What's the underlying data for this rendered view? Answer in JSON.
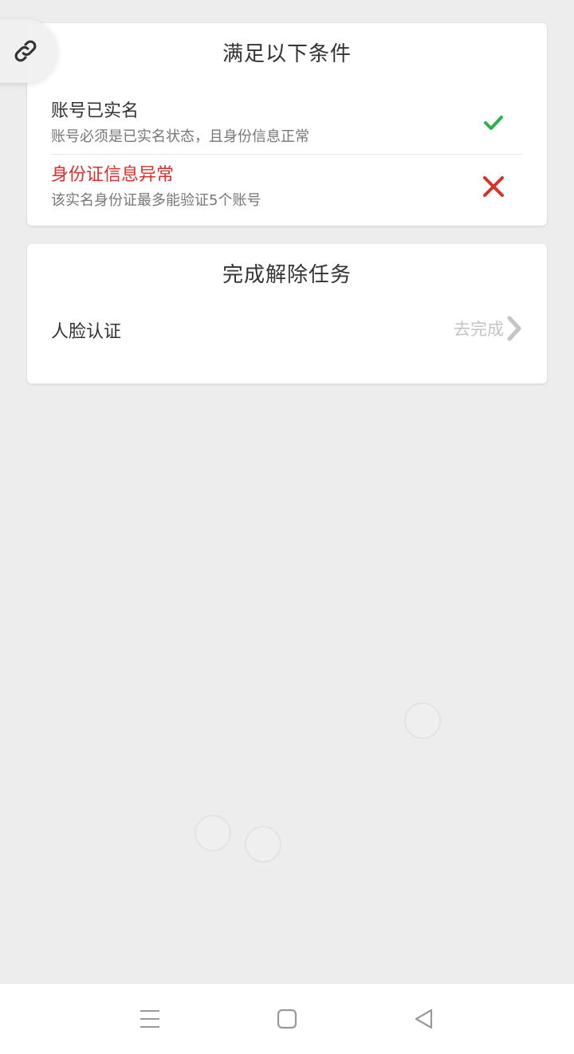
{
  "conditions": {
    "title": "满足以下条件",
    "items": [
      {
        "title": "账号已实名",
        "description": "账号必须是已实名状态，且身份信息正常",
        "status": "pass",
        "icon": "check-icon",
        "color": "#2bb24c"
      },
      {
        "title": "身份证信息异常",
        "description": "该实名身份证最多能验证5个账号",
        "status": "fail",
        "icon": "cross-icon",
        "color": "#d9302c"
      }
    ]
  },
  "tasks": {
    "title": "完成解除任务",
    "items": [
      {
        "label": "人脸认证",
        "action": "去完成",
        "icon": "chevron-right-icon"
      }
    ]
  },
  "floating_button": {
    "icon": "link-icon"
  },
  "navbar": {
    "buttons": [
      {
        "icon": "menu-icon"
      },
      {
        "icon": "home-square-icon"
      },
      {
        "icon": "back-triangle-icon"
      }
    ]
  },
  "colors": {
    "background": "#ededed",
    "card": "#ffffff",
    "error": "#d9302c",
    "success": "#2bb24c",
    "muted_action": "#c4c4c4"
  }
}
